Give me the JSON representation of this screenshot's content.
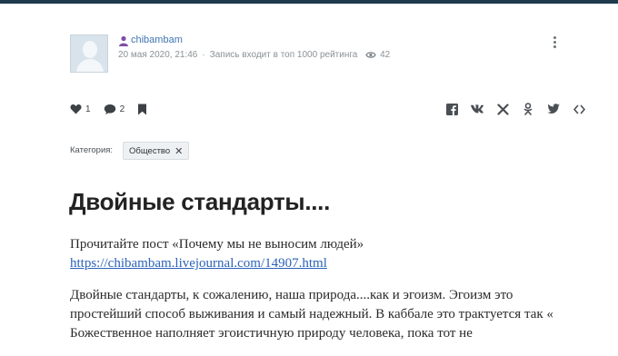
{
  "post": {
    "author": "chibambam",
    "date": "20 мая 2020, 21:46",
    "rating_note": "Запись входит в топ 1000 рейтинга",
    "views": "42",
    "likes": "1",
    "comments": "2",
    "category_label": "Категория:",
    "category": "Общество",
    "title": "Двойные стандарты....",
    "paragraph1": "Прочитайте пост «Почему мы не выносим людей»",
    "link": "https://chibambam.livejournal.com/14907.html",
    "paragraph2": "Двойные стандарты, к сожалению, наша природа....как и эгоизм. Эгоизм это простейший способ выживания и самый надежный. В каббале это трактуется так « Божественное наполняет эгоистичную природу человека, пока тот не"
  },
  "colors": {
    "topbar": "#1f3a4d",
    "link": "#2c63b8",
    "username": "#3f75b3"
  },
  "icons": [
    "user-icon",
    "eye-icon",
    "more-icon",
    "heart-icon",
    "comment-icon",
    "bookmark-icon",
    "facebook-icon",
    "vk-icon",
    "twitter-share-icon",
    "odnoklassniki-icon",
    "twitter-icon",
    "embed-icon",
    "close-icon"
  ]
}
